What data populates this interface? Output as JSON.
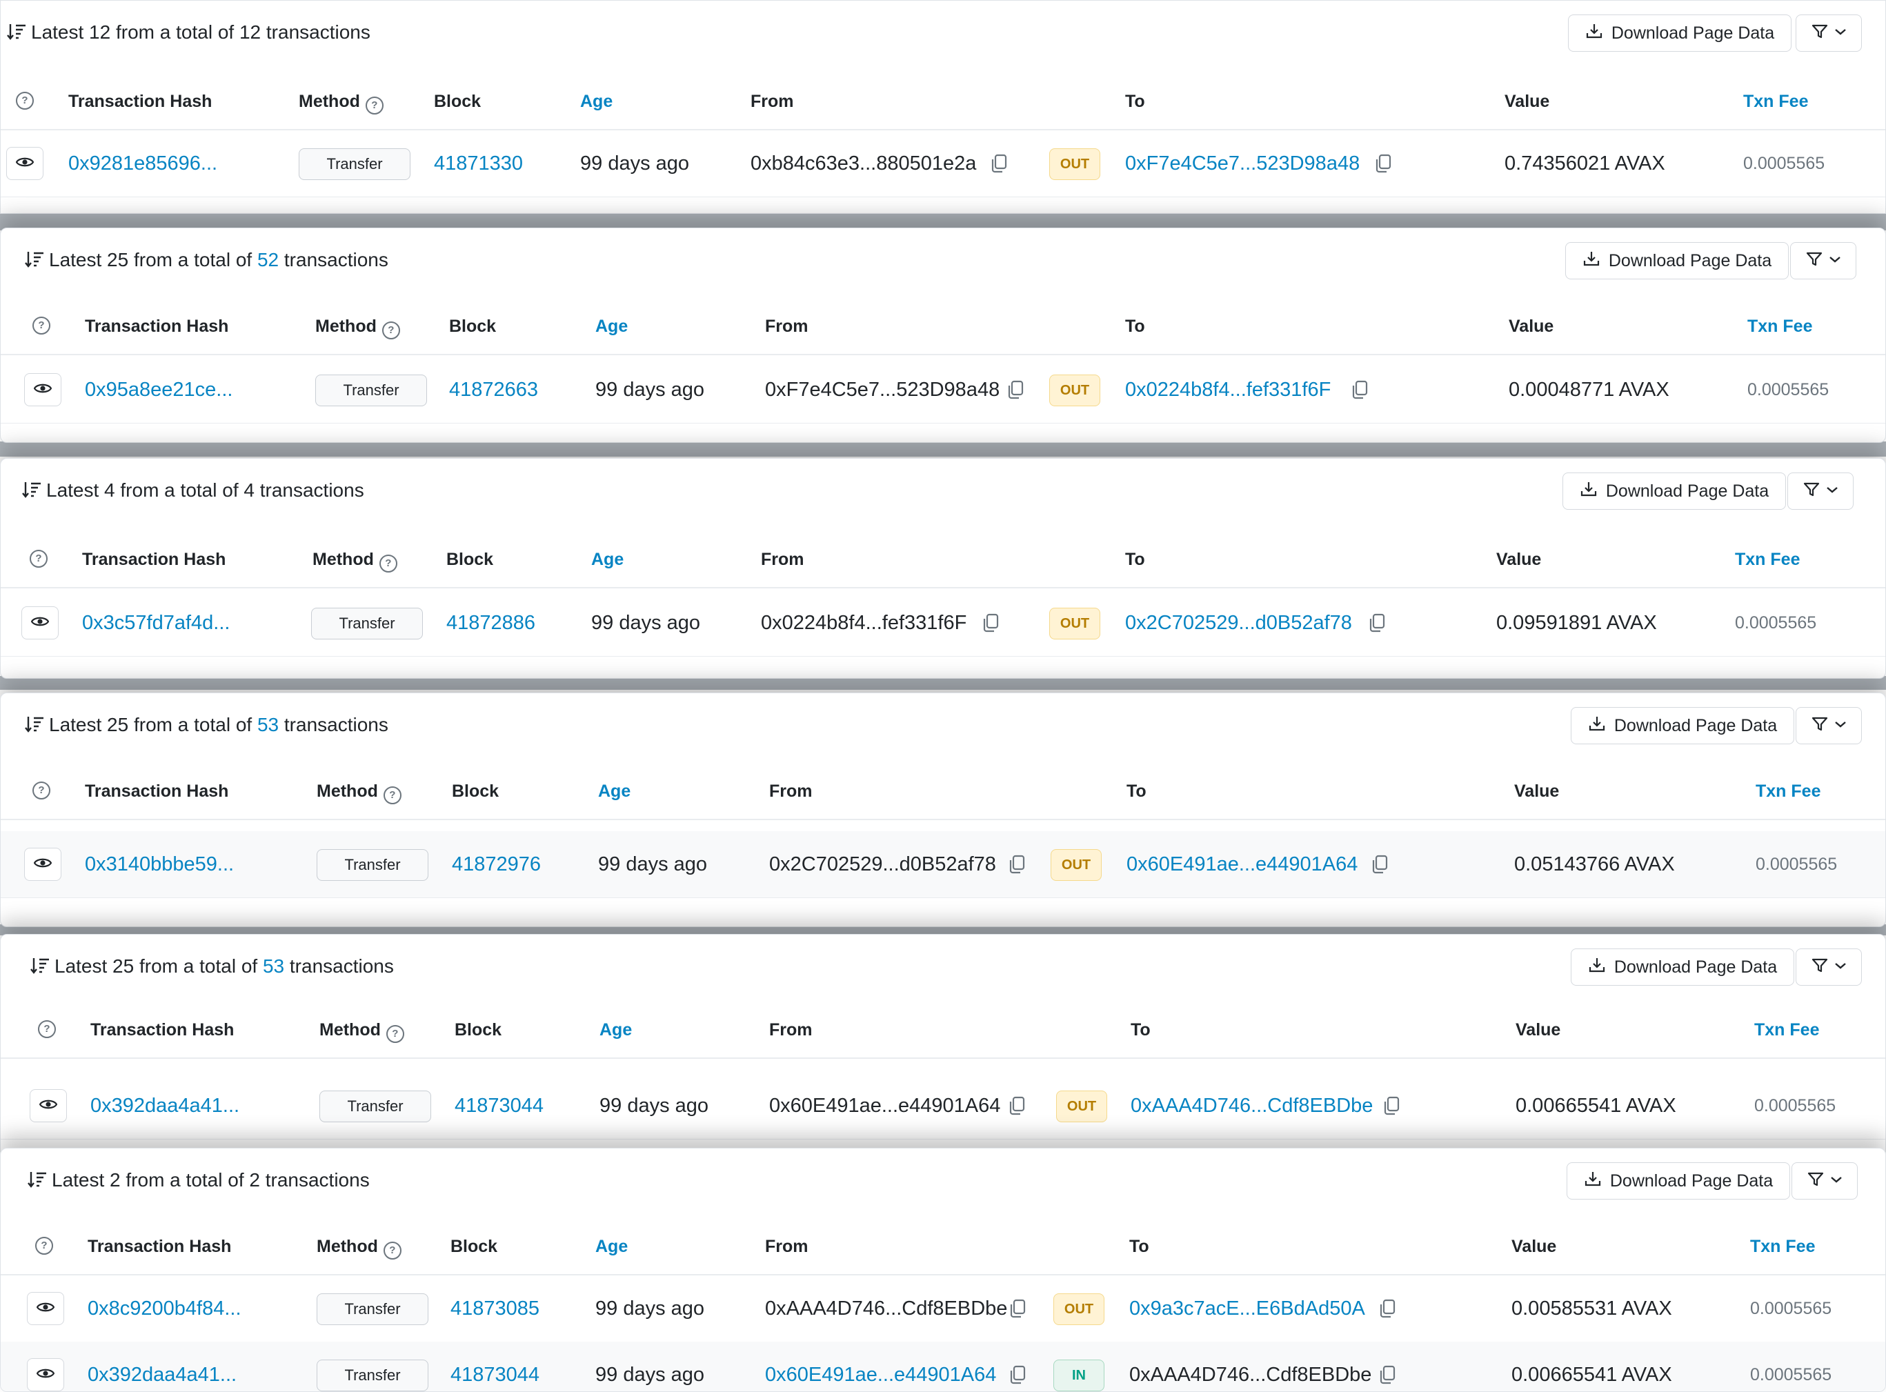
{
  "colors": {
    "link": "#0784c3",
    "out_badge": "#fff3d4",
    "in_badge": "#e8f5ef",
    "text": "#212529"
  },
  "icons": [
    "sort-icon",
    "download-icon",
    "filter-icon",
    "chevron-down-icon",
    "question-icon",
    "eye-icon",
    "copy-icon"
  ],
  "panels": [
    {
      "title_pre": "Latest 12 from a total of ",
      "total": "12",
      "title_post": " transactions",
      "download_label": "Download Page Data",
      "columns": [
        "Transaction Hash",
        "Method",
        "Block",
        "Age",
        "From",
        "To",
        "Value",
        "Txn Fee"
      ],
      "rows": [
        {
          "hash": "0x9281e85696...",
          "method": "Transfer",
          "block": "41871330",
          "age": "99 days ago",
          "from": "0xb84c63e3...880501e2a",
          "dir": "OUT",
          "to": "0xF7e4C5e7...523D98a48",
          "value": "0.74356021 AVAX",
          "fee": "0.0005565"
        }
      ]
    },
    {
      "title_pre": "Latest 25 from a total of ",
      "total": "52",
      "title_post": " transactions",
      "download_label": "Download Page Data",
      "columns": [
        "Transaction Hash",
        "Method",
        "Block",
        "Age",
        "From",
        "To",
        "Value",
        "Txn Fee"
      ],
      "rows": [
        {
          "hash": "0x95a8ee21ce...",
          "method": "Transfer",
          "block": "41872663",
          "age": "99 days ago",
          "from": "0xF7e4C5e7...523D98a48",
          "dir": "OUT",
          "to": "0x0224b8f4...fef331f6F",
          "value": "0.00048771 AVAX",
          "fee": "0.0005565"
        }
      ]
    },
    {
      "title_pre": "Latest 4 from a total of ",
      "total": "4",
      "title_post": " transactions",
      "download_label": "Download Page Data",
      "columns": [
        "Transaction Hash",
        "Method",
        "Block",
        "Age",
        "From",
        "To",
        "Value",
        "Txn Fee"
      ],
      "rows": [
        {
          "hash": "0x3c57fd7af4d...",
          "method": "Transfer",
          "block": "41872886",
          "age": "99 days ago",
          "from": "0x0224b8f4...fef331f6F",
          "dir": "OUT",
          "to": "0x2C702529...d0B52af78",
          "value": "0.09591891 AVAX",
          "fee": "0.0005565"
        }
      ]
    },
    {
      "title_pre": "Latest 25 from a total of ",
      "total": "53",
      "title_post": " transactions",
      "download_label": "Download Page Data",
      "columns": [
        "Transaction Hash",
        "Method",
        "Block",
        "Age",
        "From",
        "To",
        "Value",
        "Txn Fee"
      ],
      "rows": [
        {
          "hash": "0x3140bbbe59...",
          "method": "Transfer",
          "block": "41872976",
          "age": "99 days ago",
          "from": "0x2C702529...d0B52af78",
          "dir": "OUT",
          "to": "0x60E491ae...e44901A64",
          "value": "0.05143766 AVAX",
          "fee": "0.0005565"
        }
      ]
    },
    {
      "title_pre": "Latest 25 from a total of ",
      "total": "53",
      "title_post": " transactions",
      "download_label": "Download Page Data",
      "columns": [
        "Transaction Hash",
        "Method",
        "Block",
        "Age",
        "From",
        "To",
        "Value",
        "Txn Fee"
      ],
      "rows": [
        {
          "hash": "0x392daa4a41...",
          "method": "Transfer",
          "block": "41873044",
          "age": "99 days ago",
          "from": "0x60E491ae...e44901A64",
          "dir": "OUT",
          "to": "0xAAA4D746...Cdf8EBDbe",
          "value": "0.00665541 AVAX",
          "fee": "0.0005565"
        }
      ]
    },
    {
      "title_pre": "Latest 2 from a total of ",
      "total": "2",
      "title_post": " transactions",
      "download_label": "Download Page Data",
      "columns": [
        "Transaction Hash",
        "Method",
        "Block",
        "Age",
        "From",
        "To",
        "Value",
        "Txn Fee"
      ],
      "rows": [
        {
          "hash": "0x8c9200b4f84...",
          "method": "Transfer",
          "block": "41873085",
          "age": "99 days ago",
          "from": "0xAAA4D746...Cdf8EBDbe",
          "dir": "OUT",
          "to": "0x9a3c7acE...E6BdAd50A",
          "value": "0.00585531 AVAX",
          "fee": "0.0005565"
        },
        {
          "hash": "0x392daa4a41...",
          "method": "Transfer",
          "block": "41873044",
          "age": "99 days ago",
          "from": "0x60E491ae...e44901A64",
          "dir": "IN",
          "to": "0xAAA4D746...Cdf8EBDbe",
          "value": "0.00665541 AVAX",
          "fee": "0.0005565"
        }
      ]
    }
  ]
}
